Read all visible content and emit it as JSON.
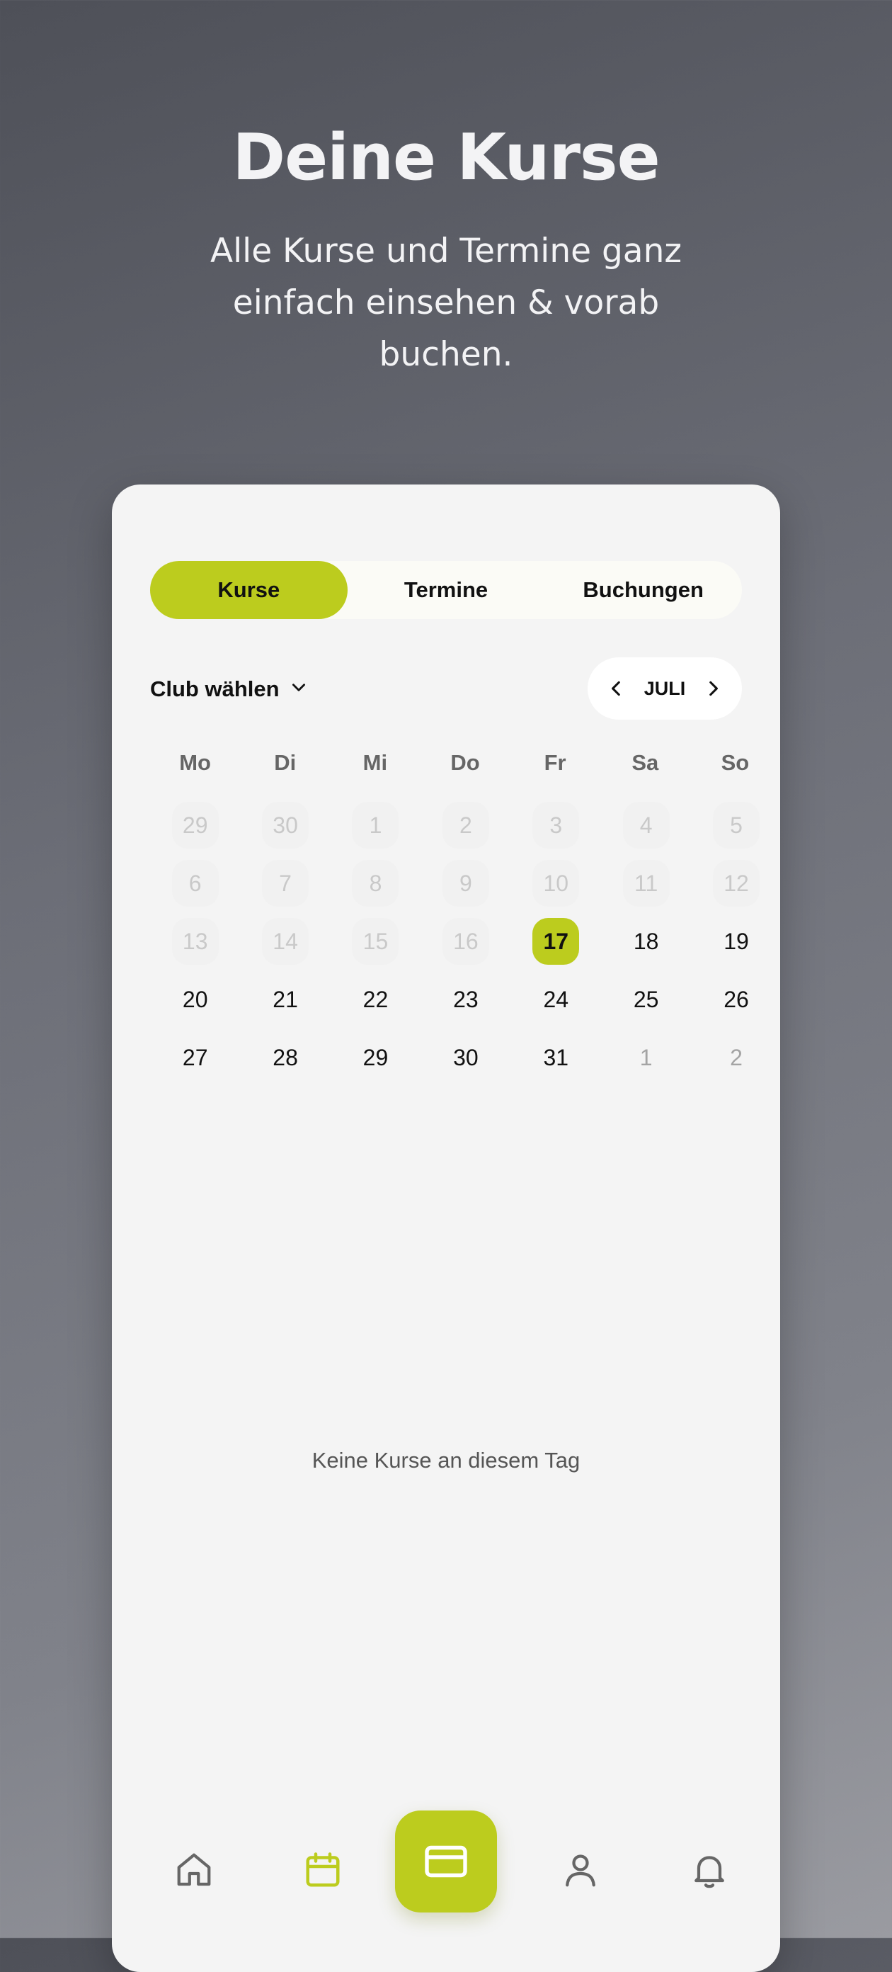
{
  "hero": {
    "title": "Deine Kurse",
    "subtitle": "Alle Kurse und Termine ganz einfach einsehen & vorab buchen."
  },
  "tabs": [
    {
      "label": "Kurse",
      "active": true
    },
    {
      "label": "Termine",
      "active": false
    },
    {
      "label": "Buchungen",
      "active": false
    }
  ],
  "club_select": {
    "label": "Club wählen",
    "icon": "chevron-down-icon"
  },
  "month_nav": {
    "label": "JULI",
    "prev_icon": "chevron-left-icon",
    "next_icon": "chevron-right-icon"
  },
  "weekdays": [
    "Mo",
    "Di",
    "Mi",
    "Do",
    "Fr",
    "Sa",
    "So"
  ],
  "calendar": {
    "days": [
      {
        "n": "29",
        "state": "muted"
      },
      {
        "n": "30",
        "state": "muted"
      },
      {
        "n": "1",
        "state": "muted"
      },
      {
        "n": "2",
        "state": "muted"
      },
      {
        "n": "3",
        "state": "muted"
      },
      {
        "n": "4",
        "state": "muted"
      },
      {
        "n": "5",
        "state": "muted"
      },
      {
        "n": "6",
        "state": "muted"
      },
      {
        "n": "7",
        "state": "muted"
      },
      {
        "n": "8",
        "state": "muted"
      },
      {
        "n": "9",
        "state": "muted"
      },
      {
        "n": "10",
        "state": "muted"
      },
      {
        "n": "11",
        "state": "muted"
      },
      {
        "n": "12",
        "state": "muted"
      },
      {
        "n": "13",
        "state": "muted"
      },
      {
        "n": "14",
        "state": "muted"
      },
      {
        "n": "15",
        "state": "muted"
      },
      {
        "n": "16",
        "state": "muted"
      },
      {
        "n": "17",
        "state": "today"
      },
      {
        "n": "18",
        "state": "normal"
      },
      {
        "n": "19",
        "state": "normal"
      },
      {
        "n": "20",
        "state": "normal"
      },
      {
        "n": "21",
        "state": "normal"
      },
      {
        "n": "22",
        "state": "normal"
      },
      {
        "n": "23",
        "state": "normal"
      },
      {
        "n": "24",
        "state": "normal"
      },
      {
        "n": "25",
        "state": "normal"
      },
      {
        "n": "26",
        "state": "normal"
      },
      {
        "n": "27",
        "state": "normal"
      },
      {
        "n": "28",
        "state": "normal"
      },
      {
        "n": "29",
        "state": "normal"
      },
      {
        "n": "30",
        "state": "normal"
      },
      {
        "n": "31",
        "state": "normal"
      },
      {
        "n": "1",
        "state": "trail"
      },
      {
        "n": "2",
        "state": "trail"
      }
    ]
  },
  "empty_message": "Keine Kurse an diesem Tag",
  "bottom_nav": [
    {
      "name": "home-icon",
      "active": false
    },
    {
      "name": "calendar-icon",
      "active": true
    },
    {
      "name": "card-icon",
      "active": false,
      "center": true
    },
    {
      "name": "user-icon",
      "active": false
    },
    {
      "name": "bell-icon",
      "active": false
    }
  ],
  "colors": {
    "accent": "#bccc1e",
    "card_bg": "#f4f4f4",
    "text": "#111111"
  }
}
